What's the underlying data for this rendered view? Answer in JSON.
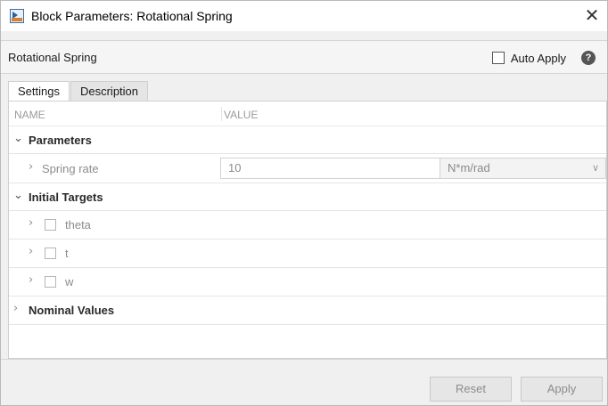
{
  "window": {
    "title": "Block Parameters: Rotational Spring",
    "close_glyph": "✕",
    "icon": "simulink-block-icon"
  },
  "header": {
    "block_name": "Rotational Spring",
    "auto_apply_label": "Auto Apply",
    "auto_apply_checked": false,
    "help_glyph": "?"
  },
  "tabs": [
    {
      "label": "Settings",
      "active": true
    },
    {
      "label": "Description",
      "active": false
    }
  ],
  "table": {
    "col_name": "NAME",
    "col_value": "VALUE",
    "groups": {
      "parameters": {
        "label": "Parameters",
        "expanded": true,
        "spring_rate": {
          "label": "Spring rate",
          "value": "10",
          "unit": "N*m/rad"
        }
      },
      "initial_targets": {
        "label": "Initial Targets",
        "expanded": true,
        "items": [
          {
            "label": "theta",
            "checked": false
          },
          {
            "label": "t",
            "checked": false
          },
          {
            "label": "w",
            "checked": false
          }
        ]
      },
      "nominal_values": {
        "label": "Nominal Values",
        "expanded": false
      }
    },
    "caret_expanded": "⌄",
    "caret_collapsed": "›",
    "dropdown_glyph": "∨"
  },
  "footer": {
    "reset_label": "Reset",
    "apply_label": "Apply"
  }
}
